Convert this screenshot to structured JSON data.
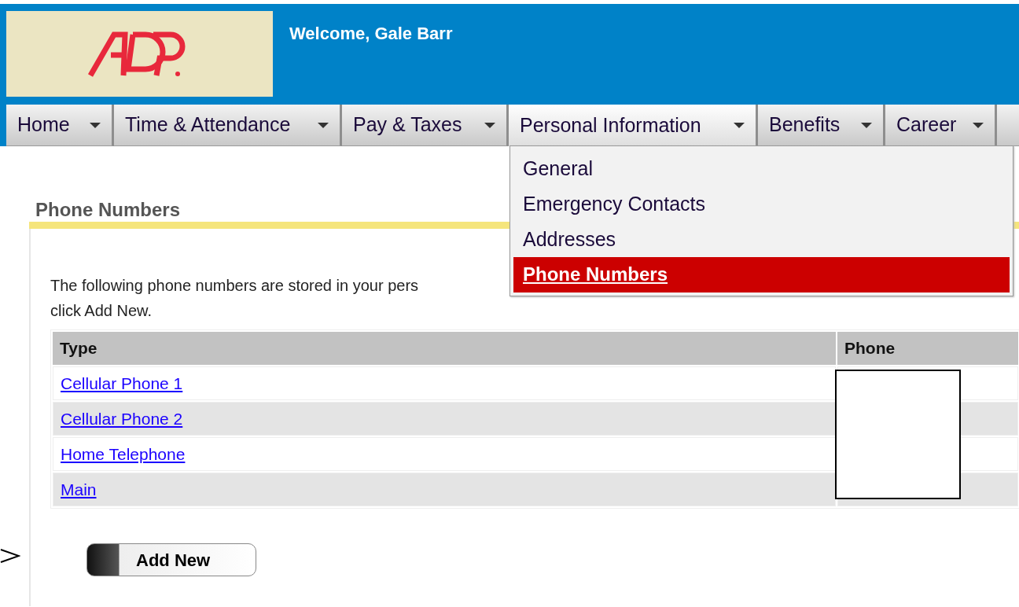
{
  "header": {
    "welcome": "Welcome, Gale Barr"
  },
  "nav": [
    {
      "label": "Home",
      "selected": false
    },
    {
      "label": "Time & Attendance",
      "selected": false
    },
    {
      "label": "Pay & Taxes",
      "selected": false
    },
    {
      "label": "Personal Information",
      "selected": true
    },
    {
      "label": "Benefits",
      "selected": false
    },
    {
      "label": "Career",
      "selected": false
    }
  ],
  "dropdown": {
    "items": [
      {
        "label": "General",
        "selected": false
      },
      {
        "label": "Emergency Contacts",
        "selected": false
      },
      {
        "label": "Addresses",
        "selected": false
      },
      {
        "label": "Phone Numbers",
        "selected": true
      }
    ]
  },
  "page": {
    "title": "Phone Numbers",
    "intro": {
      "line_1": "The following phone numbers are stored in your pers",
      "line_2": "click Add New."
    }
  },
  "table": {
    "columns": [
      "Type",
      "Phone"
    ],
    "rows": [
      {
        "type": "Cellular Phone 1"
      },
      {
        "type": "Cellular Phone 2"
      },
      {
        "type": "Home Telephone"
      },
      {
        "type": "Main"
      }
    ]
  },
  "buttons": [
    "Add New"
  ]
}
